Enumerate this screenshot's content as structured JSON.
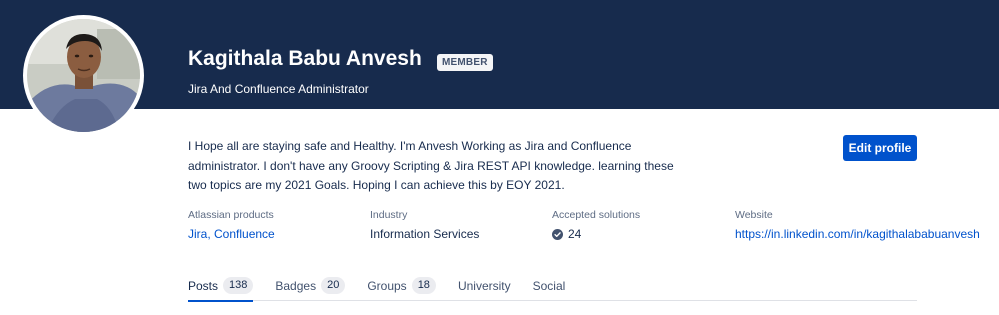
{
  "profile": {
    "name": "Kagithala Babu Anvesh",
    "badge": "MEMBER",
    "title": "Jira And Confluence Administrator",
    "bio": "I Hope all are staying safe and Healthy. I'm Anvesh Working as Jira and Confluence administrator. I don't have any Groovy Scripting & Jira REST API knowledge. learning these two topics are my 2021 Goals. Hoping I can achieve this by EOY 2021.",
    "edit_label": "Edit profile"
  },
  "info": {
    "products_label": "Atlassian products",
    "products_value": "Jira, Confluence",
    "industry_label": "Industry",
    "industry_value": "Information Services",
    "solutions_label": "Accepted solutions",
    "solutions_value": "24",
    "website_label": "Website",
    "website_value": "https://in.linkedin.com/in/kagithalababuanvesh"
  },
  "tabs": [
    {
      "label": "Posts",
      "count": "138"
    },
    {
      "label": "Badges",
      "count": "20"
    },
    {
      "label": "Groups",
      "count": "18"
    },
    {
      "label": "University"
    },
    {
      "label": "Social"
    }
  ],
  "colors": {
    "banner": "#172b4d",
    "accent": "#0052cc"
  }
}
